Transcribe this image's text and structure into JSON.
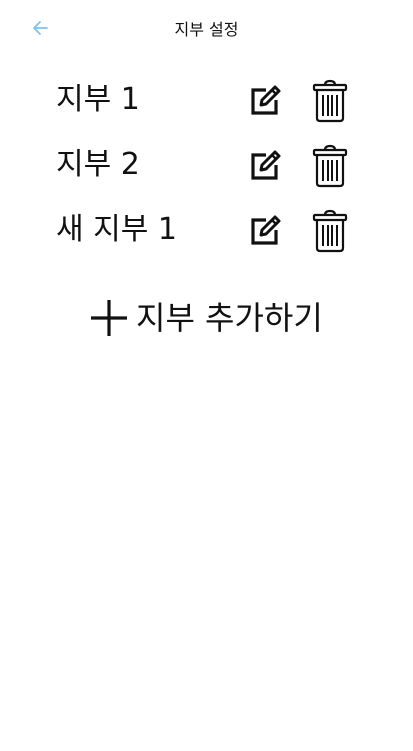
{
  "header": {
    "title": "지부 설정",
    "back_icon": "arrow-left-icon",
    "back_color": "#7fc3ee"
  },
  "branches": [
    {
      "label": "지부 1"
    },
    {
      "label": "지부 2"
    },
    {
      "label": "새 지부 1"
    }
  ],
  "row_icons": {
    "edit": "edit-pencil-icon",
    "delete": "trash-icon"
  },
  "add": {
    "label": "지부 추가하기",
    "icon": "plus-icon"
  }
}
